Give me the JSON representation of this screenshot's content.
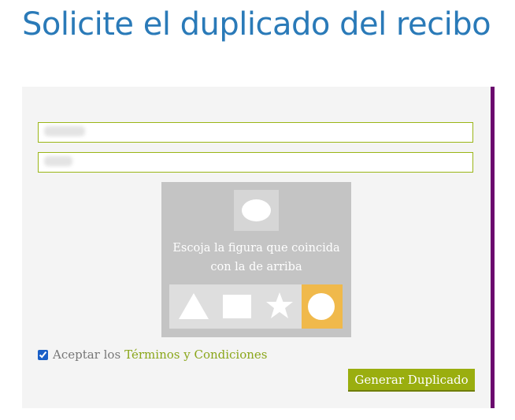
{
  "page": {
    "title": "Solicite el duplicado del recibo"
  },
  "form": {
    "field1": {
      "value": "",
      "placeholder": ""
    },
    "field2": {
      "value": "",
      "placeholder": ""
    },
    "captcha": {
      "target_icon": "ellipse-icon",
      "instruction": "Escoja la figura que coincida con la de arriba",
      "options": [
        "triangle-icon",
        "square-icon",
        "star-icon",
        "circle-icon"
      ],
      "selected_option": "circle-icon"
    },
    "terms": {
      "checked": true,
      "prefix": "Aceptar los",
      "link": "Términos y Condiciones"
    },
    "submit_label": "Generar Duplicado"
  },
  "colors": {
    "title": "#2a7ab8",
    "field_border": "#9ab516",
    "panel_accent": "#6b0a6e",
    "button": "#9aae0f",
    "selected_option": "#f0b94b"
  }
}
